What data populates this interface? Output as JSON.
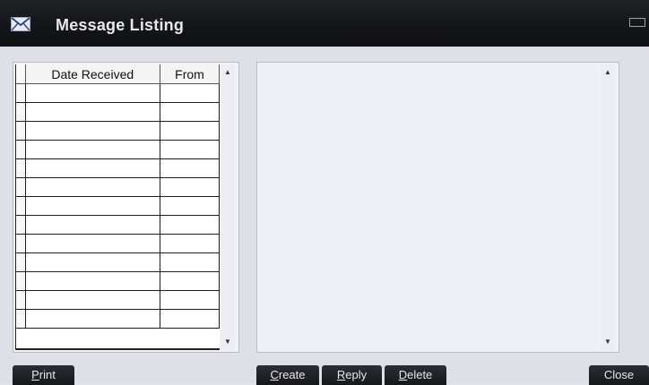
{
  "window": {
    "title": "Message Listing",
    "icon": "envelope-icon"
  },
  "list": {
    "columns": [
      "Date Received",
      "From"
    ],
    "row_count": 13,
    "rows": []
  },
  "message": {
    "body": ""
  },
  "buttons": {
    "print": {
      "accel": "P",
      "rest": "rint"
    },
    "create": {
      "accel": "C",
      "rest": "reate"
    },
    "reply": {
      "accel": "R",
      "rest": "eply"
    },
    "delete": {
      "accel": "D",
      "rest": "elete"
    },
    "close": {
      "label": "Close"
    }
  },
  "colors": {
    "titlebar": "#17181b",
    "background": "#dfe0e7",
    "button": "#222428"
  }
}
